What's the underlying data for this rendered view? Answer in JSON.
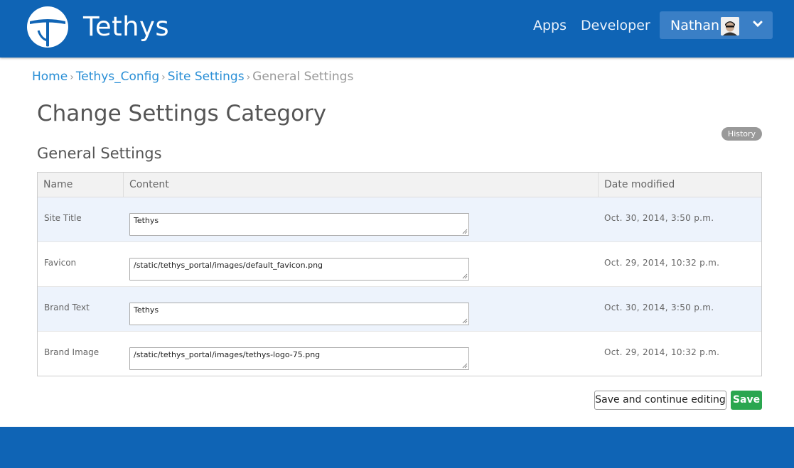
{
  "header": {
    "brand": "Tethys",
    "nav": {
      "apps": "Apps",
      "developer": "Developer"
    },
    "user": {
      "name": "Nathan"
    }
  },
  "breadcrumb": {
    "items": [
      "Home",
      "Tethys_Config",
      "Site Settings"
    ],
    "current": "General Settings",
    "separator": "›"
  },
  "page": {
    "title": "Change Settings Category",
    "history_label": "History",
    "section_title": "General Settings"
  },
  "table": {
    "columns": [
      "Name",
      "Content",
      "Date modified"
    ],
    "rows": [
      {
        "name": "Site Title",
        "content": "Tethys",
        "date": "Oct. 30, 2014, 3:50 p.m."
      },
      {
        "name": "Favicon",
        "content": "/static/tethys_portal/images/default_favicon.png",
        "date": "Oct. 29, 2014, 10:32 p.m."
      },
      {
        "name": "Brand Text",
        "content": "Tethys",
        "date": "Oct. 30, 2014, 3:50 p.m."
      },
      {
        "name": "Brand Image",
        "content": "/static/tethys_portal/images/tethys-logo-75.png",
        "date": "Oct. 29, 2014, 10:32 p.m."
      }
    ]
  },
  "actions": {
    "save_continue": "Save and continue editing",
    "save": "Save"
  },
  "colors": {
    "header_bg": "#0f64b5",
    "link": "#2a8fd6",
    "save_button": "#2aa64f",
    "row_highlight": "#edf3fc"
  },
  "icons": [
    "tethys-logo-icon",
    "user-avatar",
    "chevron-down-icon",
    "resize-grip-icon"
  ]
}
